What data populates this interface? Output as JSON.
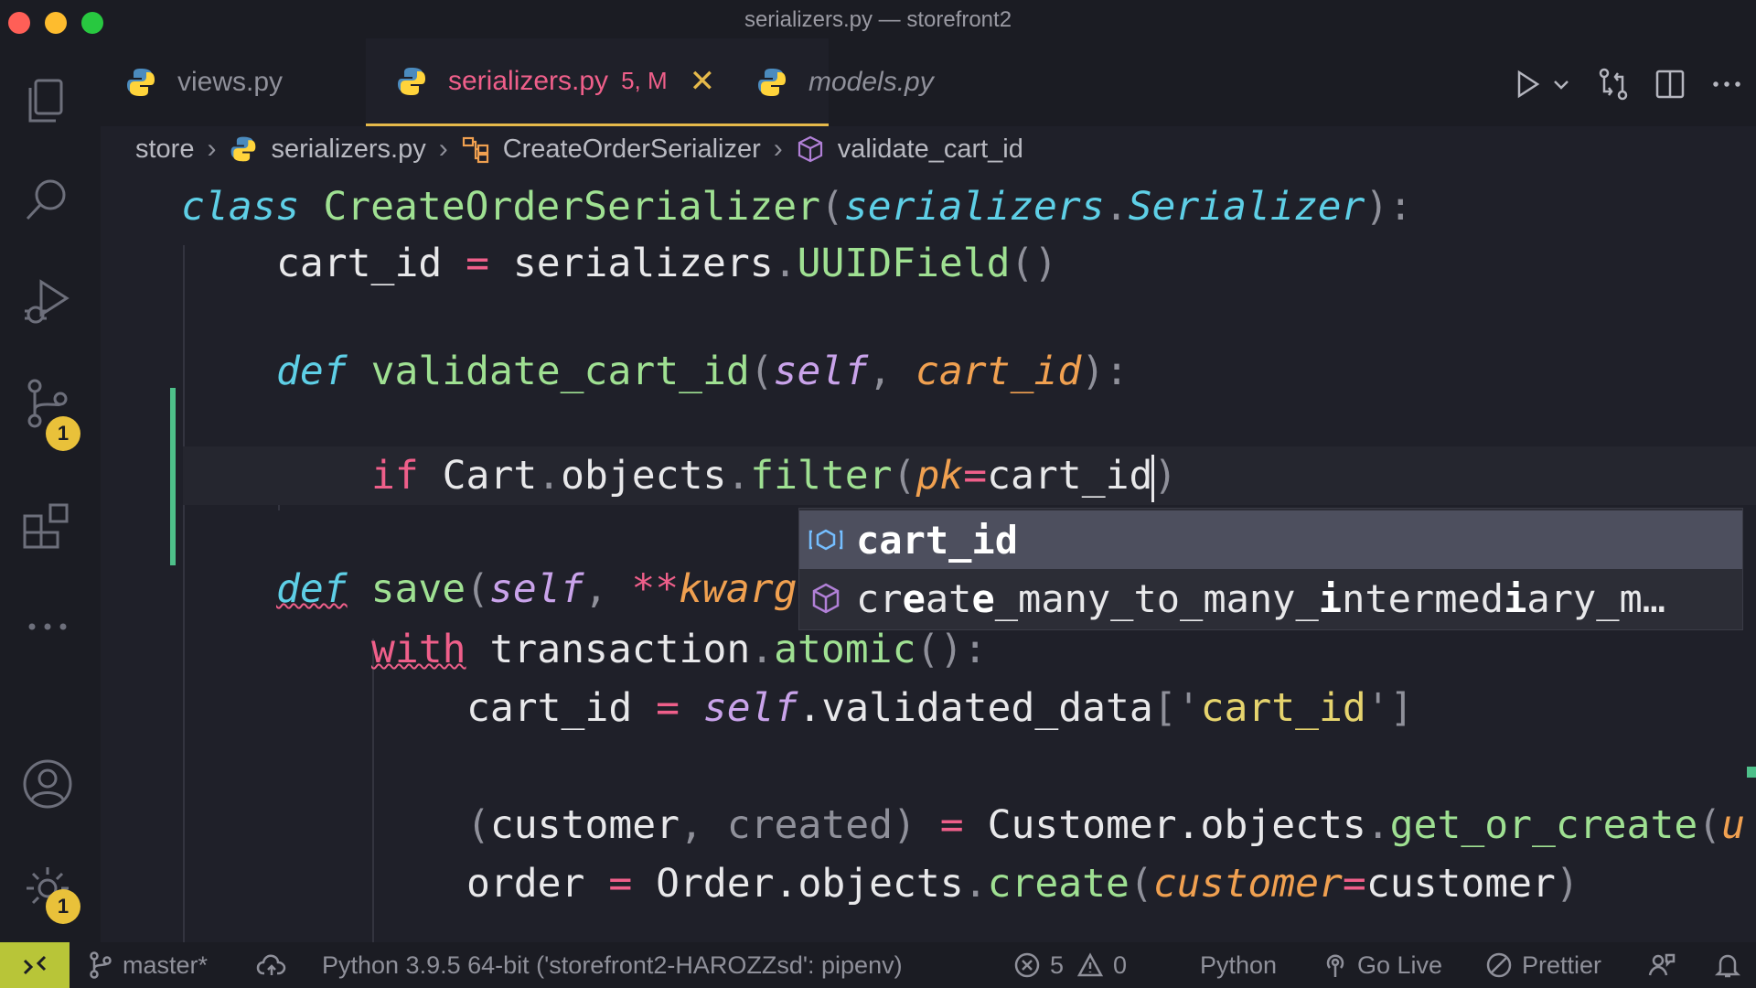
{
  "window": {
    "title": "serializers.py — storefront2"
  },
  "activity_bar": {
    "source_control_badge": "1",
    "settings_badge": "1"
  },
  "tabs": [
    {
      "label": "views.py"
    },
    {
      "label": "serializers.py",
      "modified": "5, M",
      "close": "✕"
    },
    {
      "label": "models.py"
    }
  ],
  "breadcrumb": {
    "folder": "store",
    "file": "serializers.py",
    "class": "CreateOrderSerializer",
    "method": "validate_cart_id"
  },
  "code": {
    "l1": {
      "kw": "class",
      "name": "CreateOrderSerializer",
      "p1": "(",
      "base1": "serializers",
      "dot": ".",
      "base2": "Serializer",
      "p2": "):"
    },
    "l2": {
      "var": "cart_id",
      "eq": "=",
      "obj": "serializers",
      "dot": ".",
      "fn": "UUIDField",
      "paren": "()"
    },
    "l4": {
      "kw": "def",
      "name": "validate_cart_id",
      "p1": "(",
      "self": "self",
      "comma": ",",
      "param": "cart_id",
      "p2": "):"
    },
    "l5": {
      "kw": "if",
      "cls": "Cart",
      "dot1": ".",
      "attr": "objects",
      "dot2": ".",
      "fn": "filter",
      "p1": "(",
      "kwarg": "pk",
      "eq": "=",
      "val": "cart_id",
      "p2": ")"
    },
    "l7": {
      "kw": "def",
      "name": "save",
      "p1": "(",
      "self": "self",
      "comma": ",",
      "star": "**",
      "param": "kwarg"
    },
    "l8": {
      "kw": "with",
      "obj": "transaction",
      "dot": ".",
      "fn": "atomic",
      "p": "():"
    },
    "l9": {
      "var": "cart_id",
      "eq": "=",
      "self": "self",
      "attr": ".validated_data",
      "b1": "['",
      "key": "cart_id",
      "b2": "']"
    },
    "l11": {
      "p1": "(",
      "v1": "customer",
      "comma": ",",
      "v2": "created",
      "p2": ")",
      "eq": "=",
      "cls": "Customer",
      "attr": ".objects",
      "dot": ".",
      "fn": "get_or_create",
      "p3": "(",
      "tail": "u"
    },
    "l12": {
      "var": "order",
      "eq": "=",
      "cls": "Order",
      "attr": ".objects",
      "dot": ".",
      "fn": "create",
      "p1": "(",
      "kwarg": "customer",
      "eq2": "=",
      "val": "customer",
      "p2": ")"
    }
  },
  "suggestions": {
    "item1": "cart_id",
    "item2": {
      "c1": "cr",
      "h1": "e",
      "c2": "at",
      "h2": "e",
      "c3": "_many_to_many_",
      "h3": "i",
      "c4": "ntermed",
      "h4": "i",
      "c5": "ary_m…"
    }
  },
  "status_bar": {
    "branch": "master*",
    "python": "Python 3.9.5 64-bit ('storefront2-HAROZZsd': pipenv)",
    "errors": "5",
    "warnings": "0",
    "language": "Python",
    "golive": "Go Live",
    "prettier": "Prettier"
  },
  "colors": {
    "accent_tab": "#e5b94a",
    "modified_tab": "#ef5f8a",
    "git_added": "#4ec08a",
    "remote_button": "#b8c538"
  }
}
